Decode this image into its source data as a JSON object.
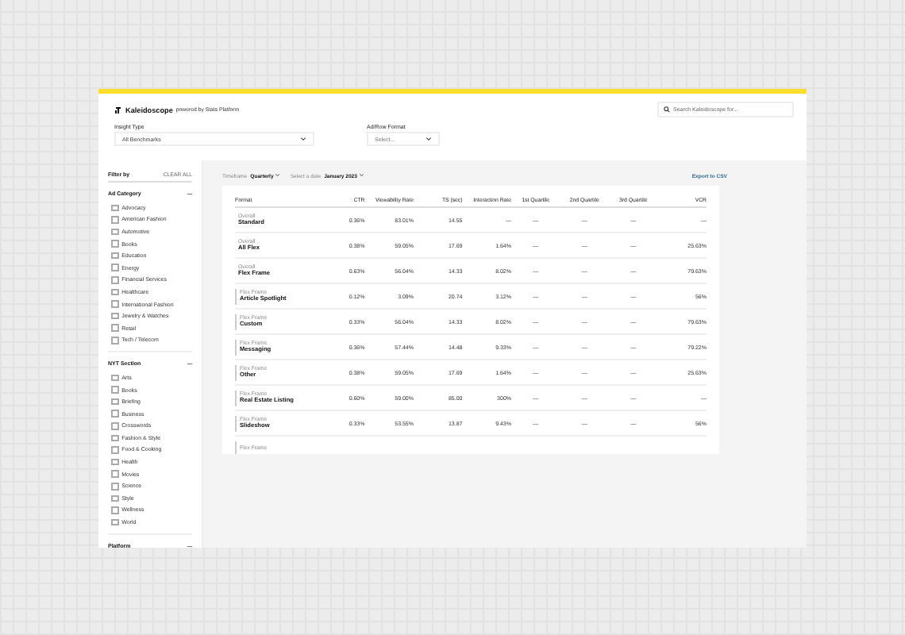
{
  "header": {
    "brand": "Kaleidoscope",
    "tagline": "powered by Stats Platform",
    "search": {
      "placeholder": "Search Kaleidoscope for..."
    },
    "filters": [
      {
        "label": "Insight Type",
        "value": "All Benchmarks"
      },
      {
        "label": "Ad/Row Format",
        "placeholder": "Select..."
      }
    ]
  },
  "sidebar": {
    "title": "Filter by",
    "clear": "CLEAR ALL",
    "sections": [
      {
        "title": "Ad Category",
        "toggle": "—",
        "items": [
          {
            "label": "Advocacy",
            "checked": false
          },
          {
            "label": "American Fashion",
            "checked": false
          },
          {
            "label": "Automotive",
            "checked": false
          },
          {
            "label": "Books",
            "checked": false
          },
          {
            "label": "Education",
            "checked": false
          },
          {
            "label": "Energy",
            "checked": false
          },
          {
            "label": "Financial Services",
            "checked": false
          },
          {
            "label": "Healthcare",
            "checked": false
          },
          {
            "label": "International Fashion",
            "checked": false
          },
          {
            "label": "Jewelry & Watches",
            "checked": false
          },
          {
            "label": "Retail",
            "checked": false
          },
          {
            "label": "Tech / Telecom",
            "checked": false
          }
        ]
      },
      {
        "title": "NYT Section",
        "toggle": "—",
        "items": [
          {
            "label": "Arts",
            "checked": false
          },
          {
            "label": "Books",
            "checked": false
          },
          {
            "label": "Briefing",
            "checked": false
          },
          {
            "label": "Business",
            "checked": false
          },
          {
            "label": "Crosswords",
            "checked": false
          },
          {
            "label": "Fashion & Style",
            "checked": false
          },
          {
            "label": "Food & Cooking",
            "checked": false
          },
          {
            "label": "Health",
            "checked": false
          },
          {
            "label": "Movies",
            "checked": false
          },
          {
            "label": "Science",
            "checked": false
          },
          {
            "label": "Style",
            "checked": false
          },
          {
            "label": "Wellness",
            "checked": false
          },
          {
            "label": "World",
            "checked": false
          }
        ]
      },
      {
        "title": "Platform",
        "toggle": "—"
      }
    ]
  },
  "toolbar": {
    "timeframe_label": "Timeframe",
    "timeframe": "Quarterly",
    "date_label": "Select a date",
    "date": "January 2023",
    "export": "Export to CSV"
  },
  "table": {
    "columns": [
      "Format",
      "CTR",
      "Viewability Rate",
      "TS (sec)",
      "Interaction Rate",
      "1st Quartile",
      "2nd Quartile",
      "3rd Quartile",
      "VCR"
    ],
    "rows": [
      {
        "kind": "summary",
        "category": "Overall",
        "name": "Standard",
        "values": [
          "0.36%",
          "83.01%",
          "14.55",
          "—",
          "—",
          "—",
          "—",
          "—"
        ]
      },
      {
        "kind": "summary",
        "category": "Overall",
        "name": "All Flex",
        "values": [
          "0.38%",
          "59.05%",
          "17.69",
          "1.64%",
          "—",
          "—",
          "—",
          "25.63%"
        ]
      },
      {
        "kind": "summary",
        "category": "Overall",
        "name": "Flex Frame",
        "values": [
          "0.63%",
          "56.04%",
          "14.33",
          "8.02%",
          "—",
          "—",
          "—",
          "79.63%"
        ]
      },
      {
        "kind": "sub",
        "category": "Flex Frame",
        "name": "Article Spotlight",
        "values": [
          "0.12%",
          "3.09%",
          "20.74",
          "3.12%",
          "—",
          "—",
          "—",
          "56%"
        ]
      },
      {
        "kind": "sub",
        "category": "Flex Frame",
        "name": "Custom",
        "values": [
          "0.33%",
          "56.04%",
          "14.33",
          "8.02%",
          "—",
          "—",
          "—",
          "79.63%"
        ]
      },
      {
        "kind": "sub",
        "category": "Flex Frame",
        "name": "Messaging",
        "values": [
          "0.36%",
          "57.44%",
          "14.48",
          "9.33%",
          "—",
          "—",
          "—",
          "79.22%"
        ]
      },
      {
        "kind": "sub",
        "category": "Flex Frame",
        "name": "Other",
        "values": [
          "0.38%",
          "59.05%",
          "17.69",
          "1.64%",
          "—",
          "—",
          "—",
          "25.63%"
        ]
      },
      {
        "kind": "sub",
        "category": "Flex Frame",
        "name": "Real Estate Listing",
        "values": [
          "0.60%",
          "59.00%",
          "85.00",
          "300%",
          "—",
          "—",
          "—",
          "—"
        ]
      },
      {
        "kind": "sub",
        "category": "Flex Frame",
        "name": "Slideshow",
        "values": [
          "0.33%",
          "53.55%",
          "13.87",
          "9.43%",
          "—",
          "—",
          "—",
          "56%"
        ]
      },
      {
        "kind": "sub",
        "category": "Flex Frame"
      }
    ]
  }
}
